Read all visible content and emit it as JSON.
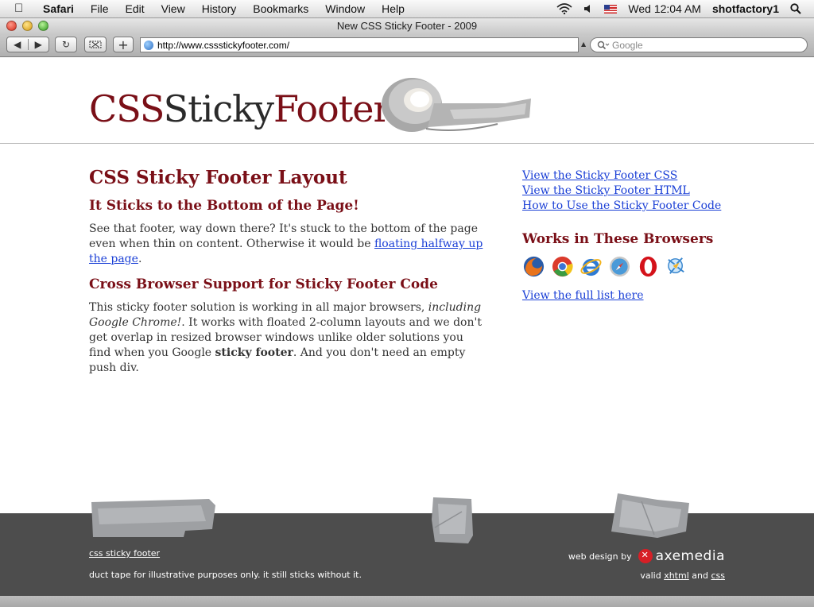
{
  "menubar": {
    "apple": "",
    "items": [
      "Safari",
      "File",
      "Edit",
      "View",
      "History",
      "Bookmarks",
      "Window",
      "Help"
    ],
    "clock": "Wed 12:04 AM",
    "user": "shotfactory1"
  },
  "window": {
    "title": "New CSS Sticky Footer - 2009"
  },
  "toolbar": {
    "back": "◀",
    "forward": "▶",
    "reload": "↻",
    "add": "+",
    "url": "http://www.cssstickyfooter.com/",
    "search_placeholder": "Google"
  },
  "header": {
    "logo_css": "CSS",
    "logo_sticky": "Sticky",
    "logo_footer": "Footer"
  },
  "main": {
    "title": "CSS Sticky Footer Layout",
    "h2_1": "It Sticks to the Bottom of the Page!",
    "p1_text": "See that footer, way down there? It's stuck to the bottom of the page even when thin on content. Otherwise it would be ",
    "p1_link": "floating halfway up the page",
    "p1_end": ".",
    "h2_2": "Cross Browser Support for Sticky Footer Code",
    "p2_a": "This sticky footer solution is working in all major browsers, ",
    "p2_em": "including Google Chrome!",
    "p2_b": ". It works with floated 2-column layouts and we don't get overlap in resized browser windows unlike older solutions you find when you Google ",
    "p2_strong": "sticky footer",
    "p2_c": ". And you don't need an empty push div."
  },
  "side": {
    "links": [
      "View the Sticky Footer CSS",
      "View the Sticky Footer HTML",
      "How to Use the Sticky Footer Code"
    ],
    "browsers_title": "Works in These Browsers",
    "browsers": [
      "firefox-icon",
      "chrome-icon",
      "ie-icon",
      "safari-icon",
      "opera-icon",
      "konqueror-icon"
    ],
    "full_list": "View the full list here"
  },
  "footer": {
    "link": "css sticky footer",
    "note": "duct tape for illustrative purposes only. it still sticks without it.",
    "design_label": "web design by",
    "brand": "axemedia",
    "valid_a": "valid ",
    "xhtml": "xhtml",
    "valid_and": " and ",
    "css": "css"
  },
  "colors": {
    "brand": "#7a0f17",
    "link": "#1a3fd6",
    "footer_bg": "#4d4d4d"
  }
}
